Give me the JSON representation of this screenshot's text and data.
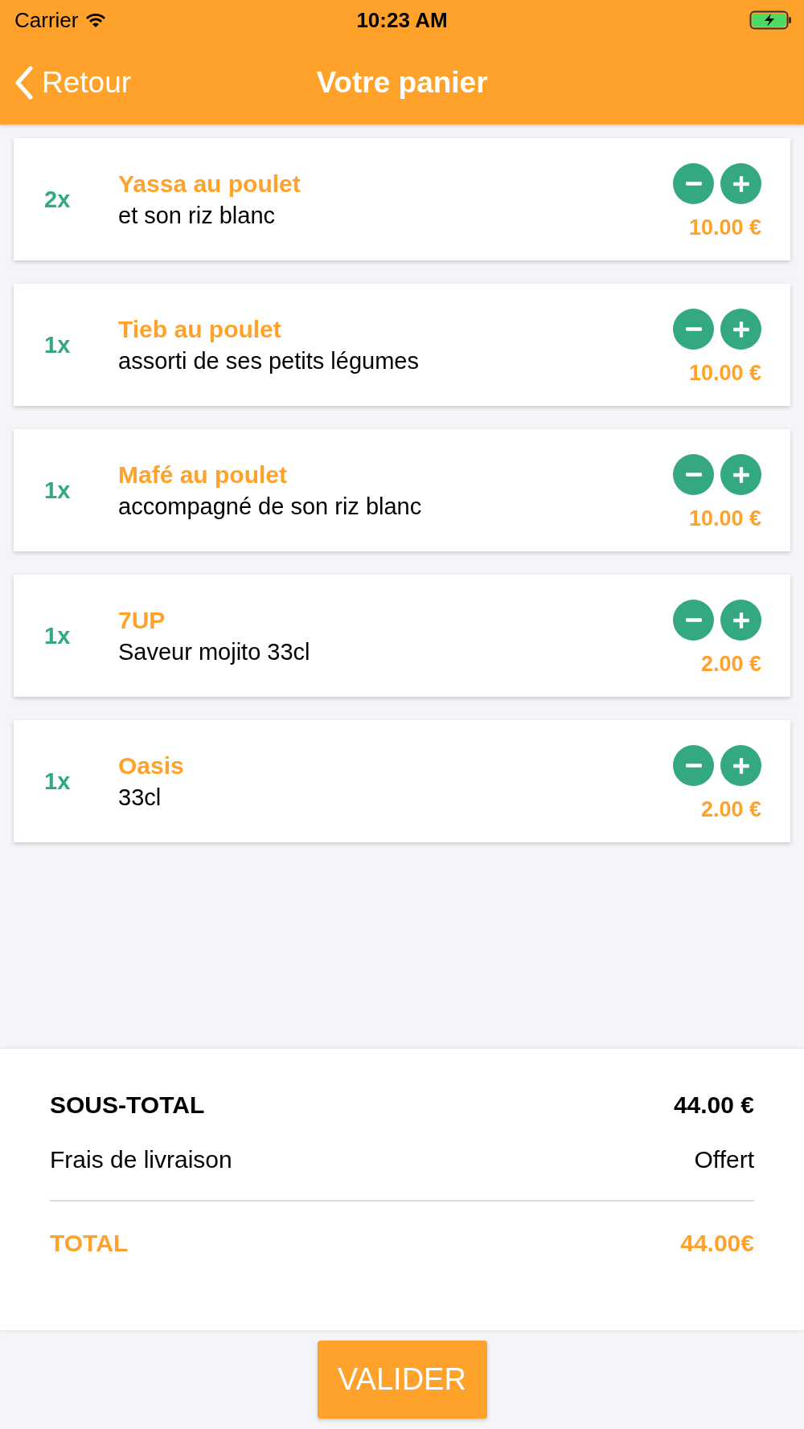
{
  "status_bar": {
    "carrier": "Carrier",
    "time": "10:23 AM"
  },
  "nav": {
    "back_label": "Retour",
    "title": "Votre panier"
  },
  "items": [
    {
      "quantity": "2x",
      "name": "Yassa au poulet",
      "description": "et son riz blanc",
      "price": "10.00 €"
    },
    {
      "quantity": "1x",
      "name": "Tieb au poulet",
      "description": "assorti de ses petits légumes",
      "price": "10.00 €"
    },
    {
      "quantity": "1x",
      "name": "Mafé au poulet",
      "description": "accompagné de son riz blanc",
      "price": "10.00 €"
    },
    {
      "quantity": "1x",
      "name": "7UP",
      "description": "Saveur mojito 33cl",
      "price": "2.00 €"
    },
    {
      "quantity": "1x",
      "name": "Oasis",
      "description": "33cl",
      "price": "2.00 €"
    }
  ],
  "summary": {
    "subtotal_label": "SOUS-TOTAL",
    "subtotal_value": "44.00 €",
    "delivery_label": "Frais de livraison",
    "delivery_value": "Offert",
    "total_label": "TOTAL",
    "total_value": "44.00€"
  },
  "validate_button": "VALIDER"
}
